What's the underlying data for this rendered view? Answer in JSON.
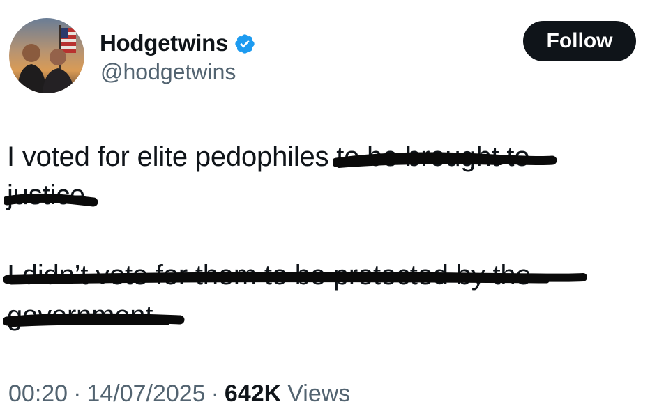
{
  "author": {
    "display_name": "Hodgetwins",
    "handle": "@hodgetwins",
    "verified": true,
    "verified_color": "#1d9bf0",
    "avatar_icon": "profile-photo"
  },
  "follow_button": {
    "label": "Follow"
  },
  "tweet": {
    "line1_plain": "I voted for elite pedophiles ",
    "line1_struck": "to be brought to",
    "line2_struck": "justice",
    "line3_struck": "I didn’t vote for them to be protected by the",
    "line4_struck": "government"
  },
  "meta": {
    "time": "00:20",
    "separator": "·",
    "date": "14/07/2025",
    "views_count": "642K",
    "views_label": "Views"
  },
  "colors": {
    "text": "#0f1419",
    "secondary": "#536471",
    "button_bg": "#0f1419",
    "marker": "#0a0a0a"
  }
}
